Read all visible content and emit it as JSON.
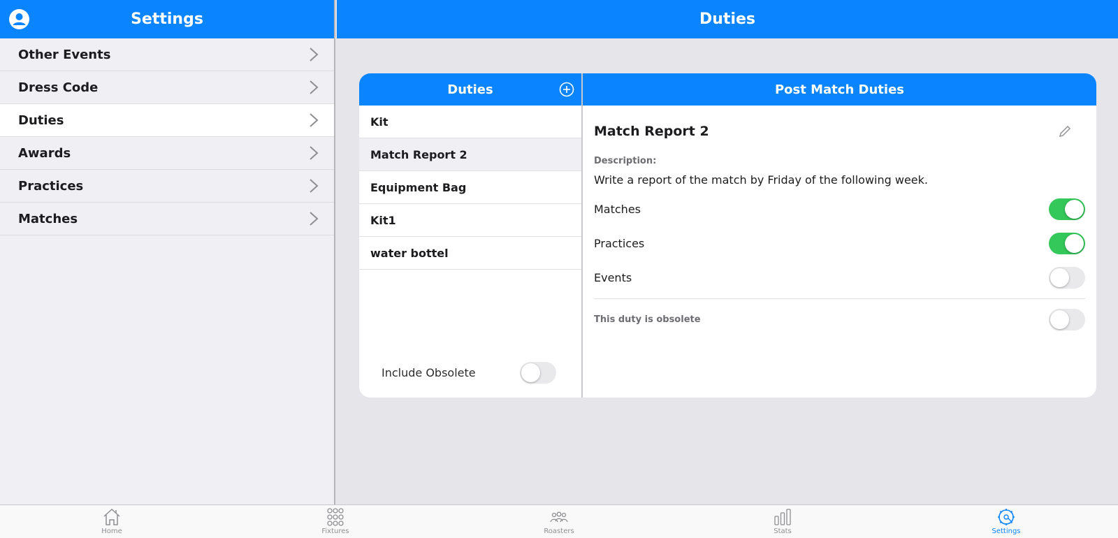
{
  "sidebar": {
    "title": "Settings",
    "items": [
      {
        "label": "Other Events"
      },
      {
        "label": "Dress Code"
      },
      {
        "label": "Duties"
      },
      {
        "label": "Awards"
      },
      {
        "label": "Practices"
      },
      {
        "label": "Matches"
      }
    ],
    "active_index": 2
  },
  "main": {
    "title": "Duties"
  },
  "duties_list": {
    "header": "Duties",
    "items": [
      {
        "label": "Kit"
      },
      {
        "label": "Match Report 2"
      },
      {
        "label": "Equipment Bag"
      },
      {
        "label": "Kit1"
      },
      {
        "label": "water bottel"
      }
    ],
    "selected_index": 1,
    "include_obsolete_label": "Include Obsolete",
    "include_obsolete": false
  },
  "detail": {
    "header": "Post Match Duties",
    "title": "Match Report 2",
    "description_label": "Description:",
    "description": "Write a report of the match by Friday of the following week.",
    "toggles": [
      {
        "label": "Matches",
        "on": true
      },
      {
        "label": "Practices",
        "on": true
      },
      {
        "label": "Events",
        "on": false
      }
    ],
    "obsolete_label": "This duty is obsolete",
    "obsolete": false
  },
  "tabbar": {
    "tabs": [
      {
        "label": "Home",
        "icon": "home-icon"
      },
      {
        "label": "Fixtures",
        "icon": "grid-icon"
      },
      {
        "label": "Roasters",
        "icon": "people-icon"
      },
      {
        "label": "Stats",
        "icon": "bar-chart-icon"
      },
      {
        "label": "Settings",
        "icon": "gear-icon"
      }
    ],
    "active_index": 4
  },
  "colors": {
    "accent": "#0a84ff",
    "toggle_on": "#34c759"
  }
}
